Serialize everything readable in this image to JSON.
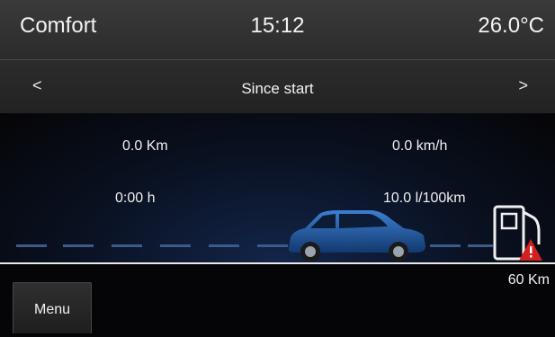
{
  "status": {
    "mode": "Comfort",
    "time": "15:12",
    "temperature": "26.0°C"
  },
  "header": {
    "title": "Since start",
    "prev": "<",
    "next": ">"
  },
  "trip": {
    "distance": "0.0 Km",
    "avg_speed": "0.0 km/h",
    "duration": "0:00 h",
    "consumption": "10.0 l/100km"
  },
  "fuel": {
    "range": "60 Km",
    "icon": "fuel-pump-warning-icon",
    "warning_color": "#d21f1f"
  },
  "car": {
    "icon": "car-icon",
    "color": "#1f5fb0"
  },
  "footer": {
    "menu_label": "Menu"
  }
}
